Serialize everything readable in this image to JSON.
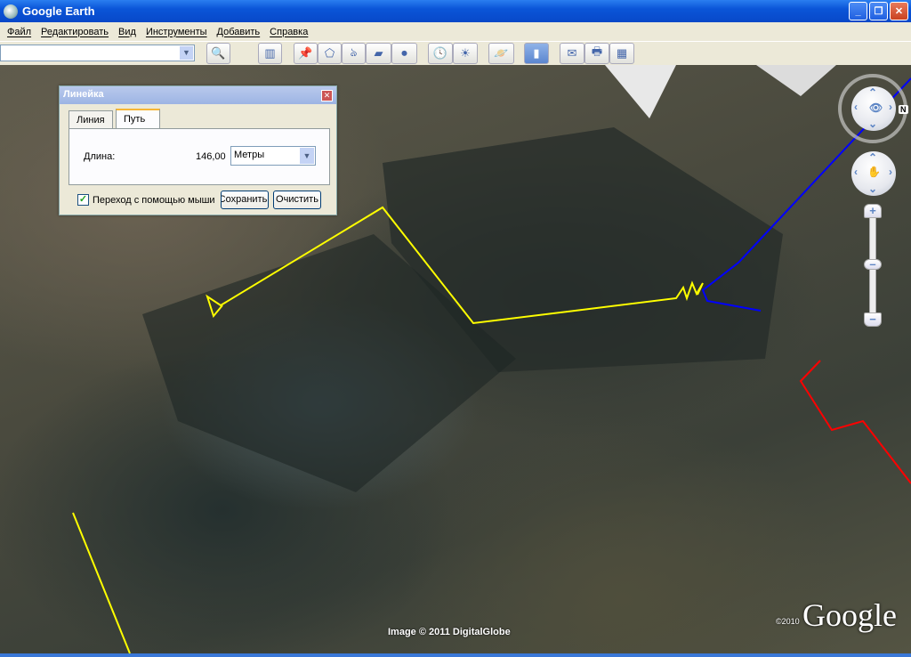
{
  "window": {
    "title": "Google Earth",
    "minimize": "_",
    "maximize": "❐",
    "close": "✕"
  },
  "menu": [
    "Файл",
    "Редактировать",
    "Вид",
    "Инструменты",
    "Добавить",
    "Справка"
  ],
  "toolbar": {
    "search_value": "",
    "search_icon": "🔍",
    "buttons": [
      {
        "name": "sidebar",
        "glyph": "▥"
      },
      {
        "name": "placemark",
        "glyph": "📌"
      },
      {
        "name": "polygon",
        "glyph": "⬠"
      },
      {
        "name": "path",
        "glyph": "ঌ"
      },
      {
        "name": "overlay",
        "glyph": "▰"
      },
      {
        "name": "tour",
        "glyph": "⏺"
      },
      {
        "name": "historical-imagery",
        "glyph": "🕓"
      },
      {
        "name": "sunlight",
        "glyph": "☀"
      },
      {
        "name": "planets",
        "glyph": "🪐"
      },
      {
        "name": "ruler",
        "glyph": "▮"
      },
      {
        "name": "email",
        "glyph": "✉"
      },
      {
        "name": "print",
        "glyph": "🖶"
      },
      {
        "name": "view-in-maps",
        "glyph": "▦"
      }
    ]
  },
  "ruler": {
    "title": "Линейка",
    "tabs": [
      "Линия",
      "Путь"
    ],
    "active_tab": "Путь",
    "length_label": "Длина:",
    "length_value": "146,00",
    "unit": "Метры",
    "mouse_nav_label": "Переход с помощью мыши",
    "mouse_nav_checked": true,
    "save": "Сохранить",
    "clear": "Очистить"
  },
  "nav": {
    "north": "N",
    "zoom_in": "+",
    "zoom_out": "−"
  },
  "map": {
    "attribution": "Image © 2011 DigitalGlobe",
    "copyright": "©2010",
    "logo": "Google"
  },
  "colors": {
    "path": "#ffff00",
    "blue_line": "#0000ff",
    "red_line": "#ff0000"
  }
}
